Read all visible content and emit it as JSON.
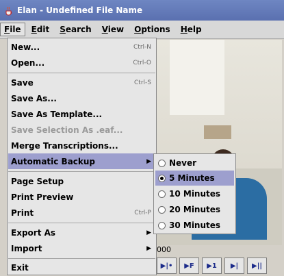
{
  "window": {
    "title": "Elan - Undefined File Name",
    "app_icon": "java-cup-icon"
  },
  "menubar": {
    "items": [
      "File",
      "Edit",
      "Search",
      "View",
      "Options",
      "Help"
    ],
    "active": "File"
  },
  "file_menu": {
    "items": [
      {
        "label": "New...",
        "accel": "Ctrl-N"
      },
      {
        "label": "Open...",
        "accel": "Ctrl-O"
      },
      {
        "label": "Save",
        "accel": "Ctrl-S"
      },
      {
        "label": "Save As...",
        "accel": ""
      },
      {
        "label": "Save As Template...",
        "accel": ""
      },
      {
        "label": "Save Selection As .eaf...",
        "accel": "",
        "disabled": true
      },
      {
        "label": "Merge Transcriptions...",
        "accel": ""
      },
      {
        "label": "Automatic Backup",
        "accel": "",
        "submenu": true,
        "highlighted": true
      },
      {
        "label": "Page Setup",
        "accel": ""
      },
      {
        "label": "Print Preview",
        "accel": ""
      },
      {
        "label": "Print",
        "accel": "Ctrl-P"
      },
      {
        "label": "Export As",
        "accel": "",
        "submenu": true
      },
      {
        "label": "Import",
        "accel": "",
        "submenu": true
      },
      {
        "label": "Exit",
        "accel": ""
      }
    ]
  },
  "backup_submenu": {
    "items": [
      {
        "label": "Never",
        "selected": false
      },
      {
        "label": "5 Minutes",
        "selected": true,
        "highlighted": true
      },
      {
        "label": "10 Minutes",
        "selected": false
      },
      {
        "label": "20 Minutes",
        "selected": false
      },
      {
        "label": "30 Minutes",
        "selected": false
      }
    ]
  },
  "player": {
    "status_fragment": "000",
    "controls": [
      "▶|•",
      "▶F",
      "▶1",
      "▶|",
      "▶||"
    ]
  },
  "colors": {
    "title_bar": "#5a70b0",
    "menu_highlight": "#9d9fce",
    "menu_bg": "#e6e6e6"
  }
}
